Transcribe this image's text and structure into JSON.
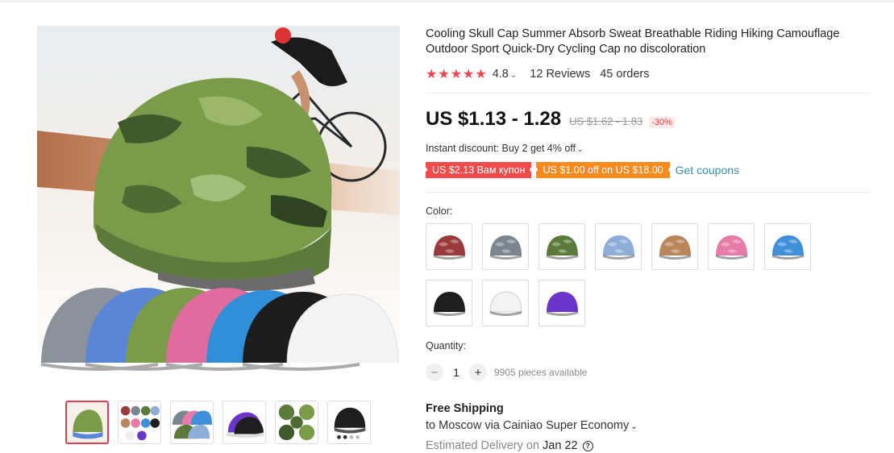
{
  "product": {
    "title": "Cooling Skull Cap Summer Absorb Sweat Breathable Riding Hiking Camouflage Outdoor Sport Quick-Dry Cycling Cap no discoloration",
    "stars": "★★★★★",
    "rating": "4.8",
    "reviews": "12 Reviews",
    "orders": "45 orders"
  },
  "price": {
    "current": "US $1.13 - 1.28",
    "original": "US $1.62 - 1.83",
    "discount": "-30%"
  },
  "promo": {
    "instant_discount": "Instant discount: Buy 2 get 4% off",
    "coupon_1": "US $2.13 Вам купон",
    "coupon_2": "US $1.00 off on US $18.00",
    "get_coupons": "Get coupons"
  },
  "options": {
    "color_label": "Color:",
    "colors": [
      "red-camo",
      "gray-camo",
      "green-camo",
      "blue-camo",
      "orange-camo",
      "pink-camo",
      "sky-blue-camo",
      "black",
      "white",
      "purple"
    ],
    "swatch_colors": [
      "#9a3a3a",
      "#7a8590",
      "#5b7a3b",
      "#8eaed8",
      "#b9865a",
      "#e57ba8",
      "#3f8fd9",
      "#1e1e1e",
      "#f3f3f3",
      "#6a35c8"
    ]
  },
  "quantity": {
    "label": "Quantity:",
    "minus": "−",
    "value": "1",
    "plus": "+",
    "available": "9905 pieces available"
  },
  "shipping": {
    "title": "Free Shipping",
    "destination": "to Moscow via Cainiao Super Economy",
    "estimated_label": "Estimated Delivery on",
    "date": "Jan 22",
    "help": "?"
  },
  "gallery": {
    "thumbnail_count": 6,
    "active_thumbnail": 1
  },
  "colors": {
    "accent_red": "#f0454f",
    "coupon_red": "#f24b4b",
    "coupon_orange": "#fc8a1c",
    "link_teal": "#3b8ea5"
  }
}
